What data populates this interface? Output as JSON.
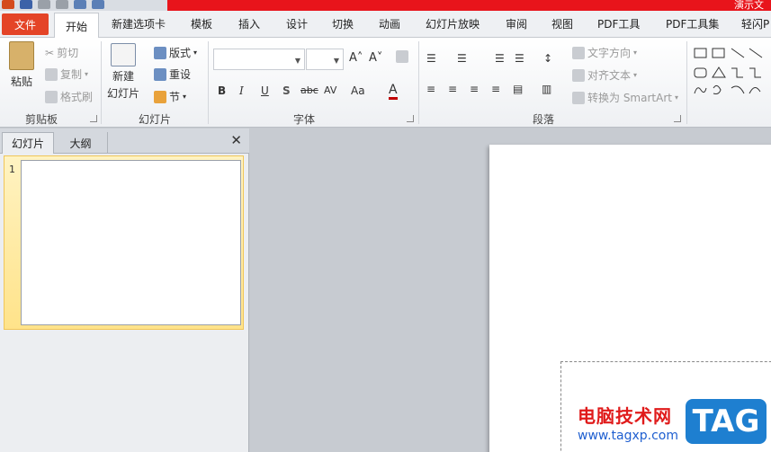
{
  "titlebar": {
    "title": "演示文"
  },
  "tabs": {
    "file": "文件",
    "items": [
      "开始",
      "新建选项卡",
      "模板",
      "插入",
      "设计",
      "切换",
      "动画",
      "幻灯片放映",
      "审阅",
      "视图",
      "PDF工具",
      "PDF工具集",
      "轻闪P"
    ]
  },
  "ribbon": {
    "clipboard": {
      "paste": "粘贴",
      "cut": "剪切",
      "copy": "复制",
      "format_painter": "格式刷",
      "label": "剪贴板"
    },
    "slides": {
      "new_line1": "新建",
      "new_line2": "幻灯片",
      "layout": "版式",
      "reset": "重设",
      "section": "节",
      "label": "幻灯片"
    },
    "font": {
      "label": "字体",
      "bold": "B",
      "italic": "I",
      "underline": "U",
      "shadow": "S",
      "strike": "abc",
      "spacing": "AV",
      "case": "Aa",
      "color": "A"
    },
    "paragraph": {
      "text_direction": "文字方向",
      "align_text": "对齐文本",
      "smartart": "转换为 SmartArt",
      "label": "段落"
    }
  },
  "panel": {
    "tab_slides": "幻灯片",
    "tab_outline": "大纲",
    "slide_number": "1"
  },
  "watermark": {
    "text": "电脑技术网",
    "url": "www.tagxp.com",
    "tag": "TAG"
  },
  "colors": {
    "accent_red": "#e8141b",
    "file_tab": "#e44427",
    "thumb_highlight": "#ffe38a"
  }
}
